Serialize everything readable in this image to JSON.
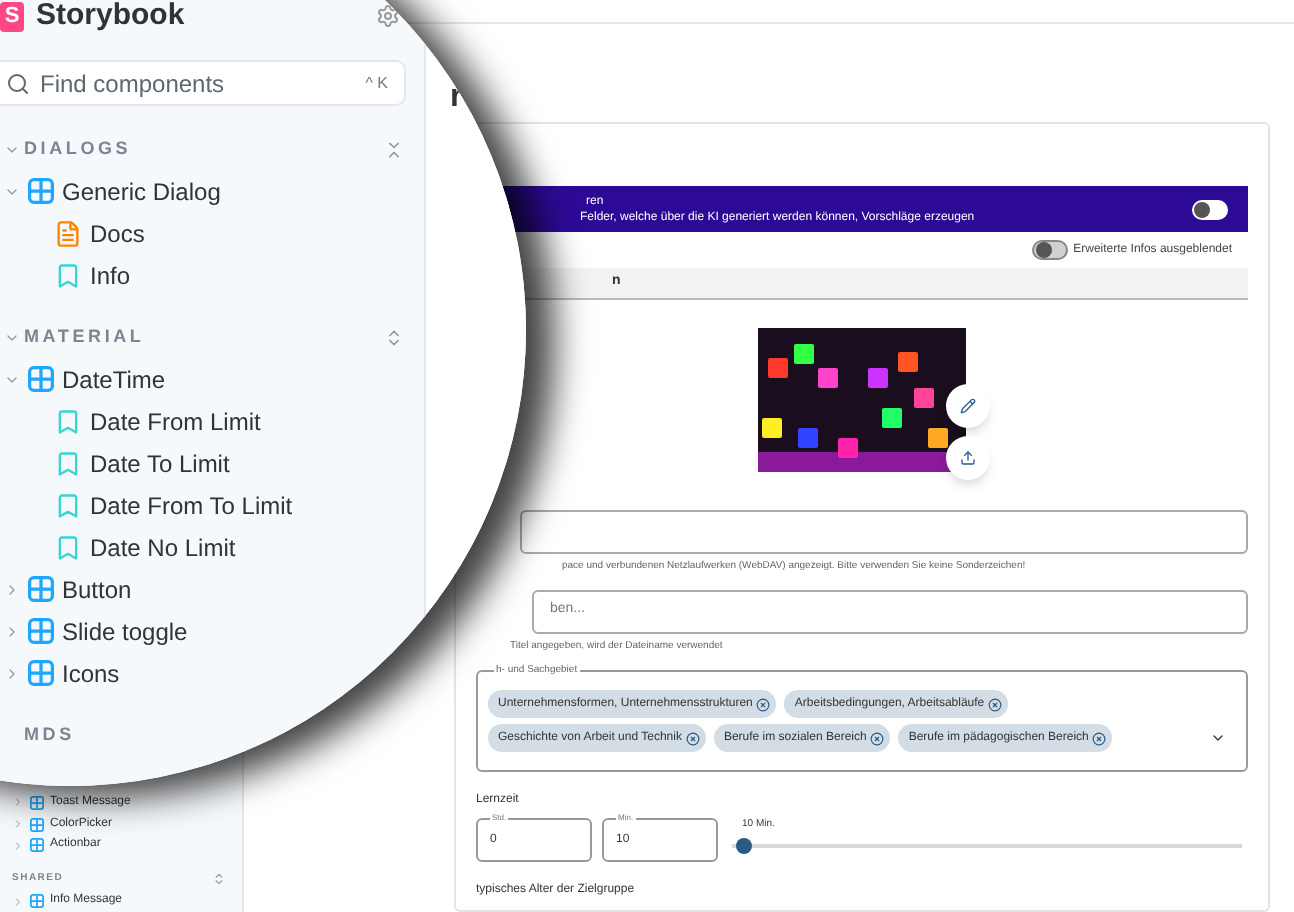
{
  "lens": {
    "logo": "S",
    "brand": "Storybook",
    "search": {
      "placeholder": "Find components",
      "shortcut": "^ K"
    },
    "sections": [
      {
        "title": "DIALOGS",
        "expanded": true,
        "all_expanded": true,
        "items": [
          {
            "label": "Generic Dialog",
            "kind": "component",
            "expanded": true,
            "children": [
              {
                "label": "Docs",
                "kind": "docs"
              },
              {
                "label": "Info",
                "kind": "story"
              }
            ]
          }
        ]
      },
      {
        "title": "MATERIAL",
        "expanded": true,
        "all_expanded": false,
        "items": [
          {
            "label": "DateTime",
            "kind": "component",
            "expanded": true,
            "children": [
              {
                "label": "Date From Limit",
                "kind": "story"
              },
              {
                "label": "Date To Limit",
                "kind": "story"
              },
              {
                "label": "Date From To Limit",
                "kind": "story"
              },
              {
                "label": "Date No Limit",
                "kind": "story"
              }
            ]
          },
          {
            "label": "Button",
            "kind": "component",
            "expanded": false
          },
          {
            "label": "Slide toggle",
            "kind": "component",
            "expanded": false
          },
          {
            "label": "Icons",
            "kind": "component",
            "expanded": false
          }
        ]
      },
      {
        "title": "MDS"
      }
    ],
    "page_title": "r"
  },
  "sidebar": {
    "items": [
      {
        "label": "Toast Message",
        "expanded": false
      },
      {
        "label": "ColorPicker",
        "expanded": false
      },
      {
        "label": "Actionbar",
        "expanded": false
      }
    ],
    "section": {
      "title": "SHARED",
      "items": [
        {
          "label": "Info Message",
          "expanded": false
        }
      ]
    }
  },
  "main": {
    "banner": {
      "title": "ren",
      "text": "Felder, welche über die KI generiert werden können, Vorschläge erzeugen",
      "on": false
    },
    "info_toggle": {
      "label": "Erweiterte Infos ausgeblendet",
      "on": false
    },
    "tab": "n",
    "fields": [
      {
        "helper": "pace und verbundenen Netzlaufwerken (WebDAV) angezeigt. Bitte verwenden Sie keine Sonderzeichen!"
      },
      {
        "placeholder": "ben...",
        "helper": "Titel angegeben, wird der Dateiname verwendet"
      }
    ],
    "subjects": {
      "legend": "h- und Sachgebiet",
      "chips": [
        "Unternehmensformen, Unternehmensstrukturen",
        "Arbeitsbedingungen, Arbeitsabläufe",
        "Geschichte von Arbeit und Technik",
        "Berufe im sozialen Bereich",
        "Berufe im pädagogischen Bereich"
      ]
    },
    "learning_time": {
      "label": "Lernzeit",
      "hours": {
        "label": "Std.",
        "value": "0"
      },
      "minutes": {
        "label": "Min.",
        "value": "10"
      },
      "reading": "10 Min.",
      "level": 0.01
    },
    "age_label": "typisches Alter der Zielgruppe"
  }
}
